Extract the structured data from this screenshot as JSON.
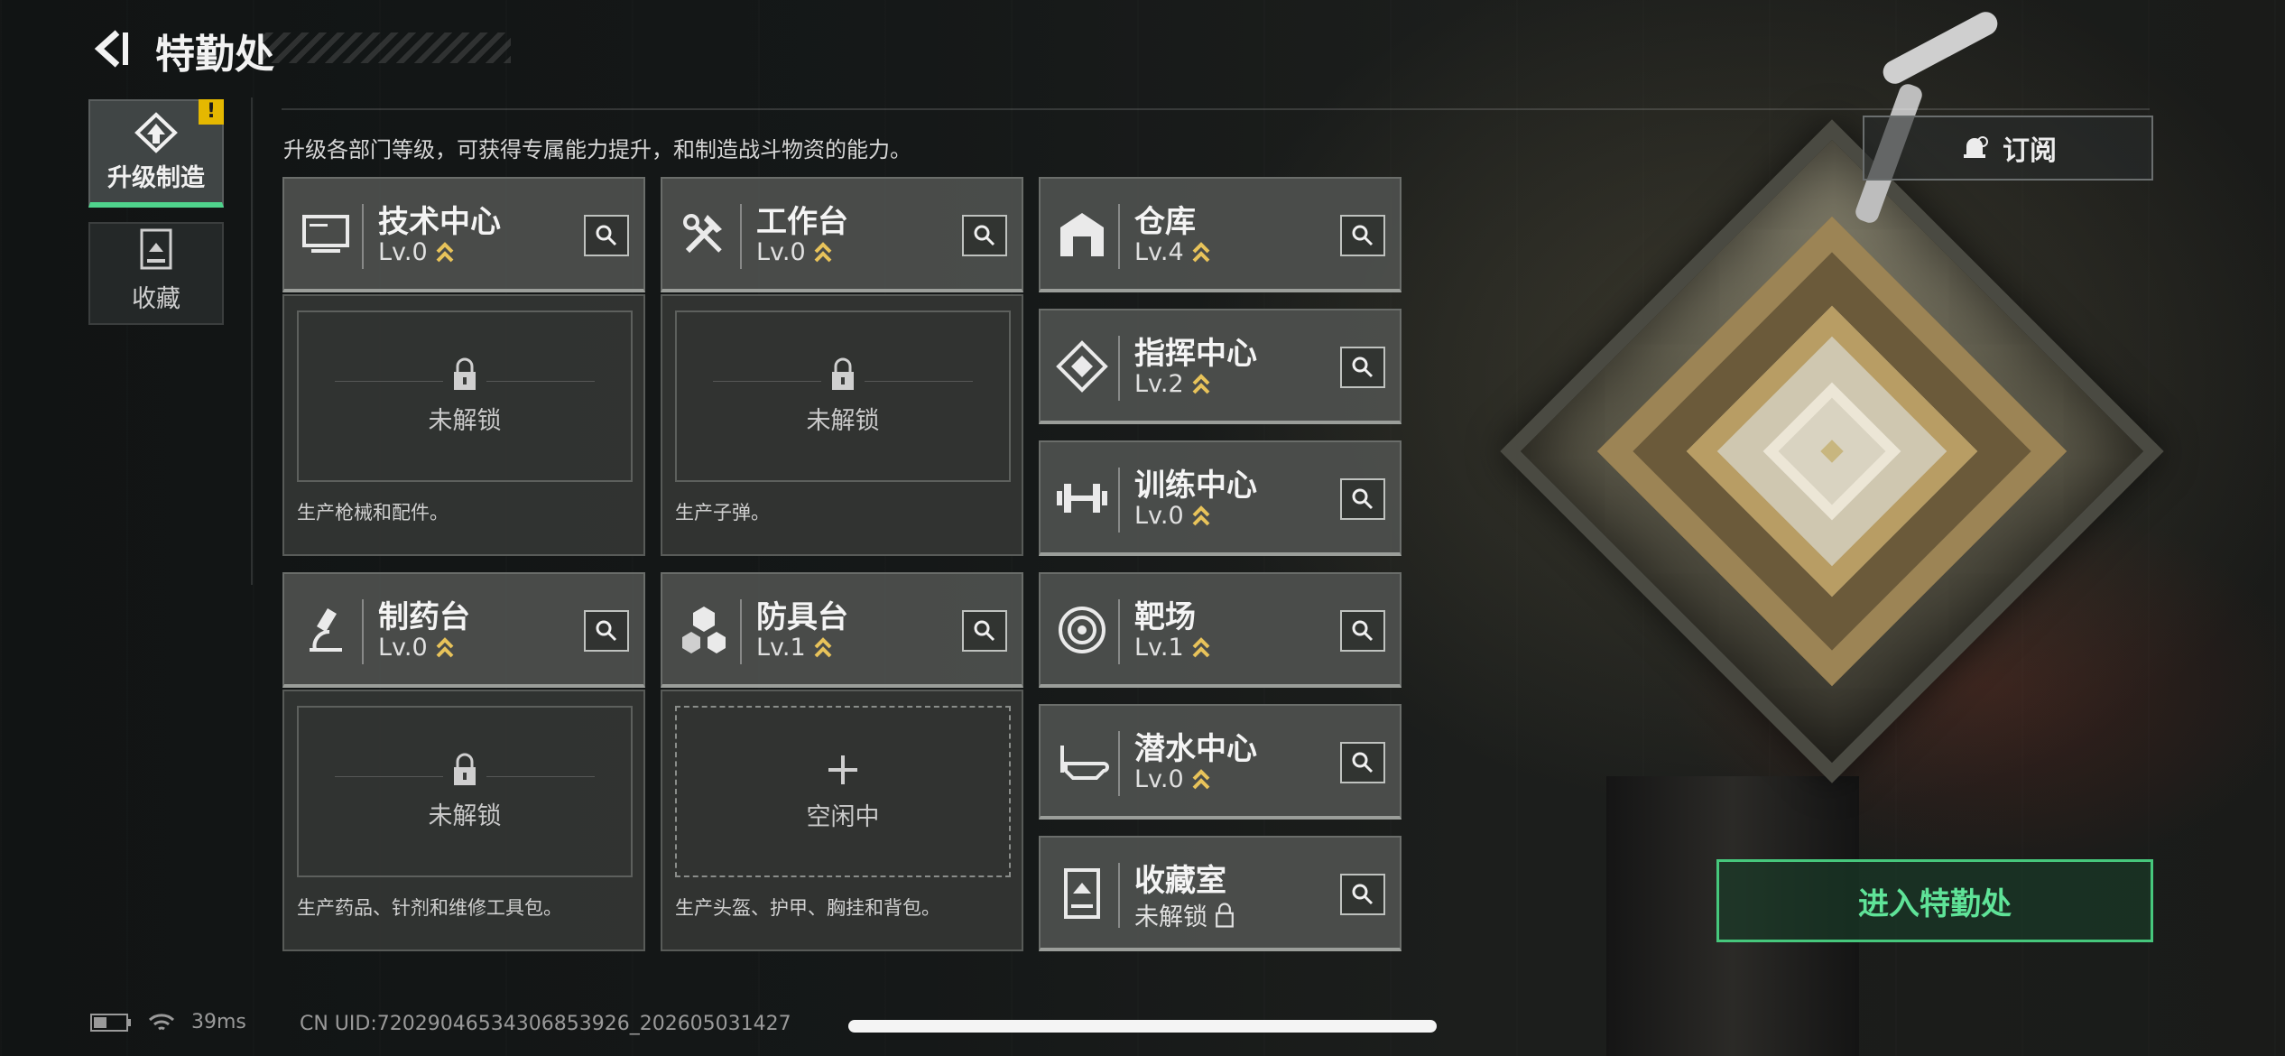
{
  "header": {
    "title": "特勤处"
  },
  "sidebar": {
    "tabs": [
      {
        "label": "升级制造",
        "active": true,
        "badge": "!"
      },
      {
        "label": "收藏",
        "active": false
      }
    ]
  },
  "description": "升级各部门等级，可获得专属能力提升，和制造战斗物资的能力。",
  "subscribe_label": "订阅",
  "facilities": {
    "tech": {
      "name": "技术中心",
      "level": "Lv.0",
      "slot_status": "未解锁",
      "desc": "生产枪械和配件。"
    },
    "workbench": {
      "name": "工作台",
      "level": "Lv.0",
      "slot_status": "未解锁",
      "desc": "生产子弹。"
    },
    "warehouse": {
      "name": "仓库",
      "level": "Lv.4"
    },
    "command": {
      "name": "指挥中心",
      "level": "Lv.2"
    },
    "training": {
      "name": "训练中心",
      "level": "Lv.0"
    },
    "pharmacy": {
      "name": "制药台",
      "level": "Lv.0",
      "slot_status": "未解锁",
      "desc": "生产药品、针剂和维修工具包。"
    },
    "armor": {
      "name": "防具台",
      "level": "Lv.1",
      "slot_status": "空闲中",
      "desc": "生产头盔、护甲、胸挂和背包。"
    },
    "range": {
      "name": "靶场",
      "level": "Lv.1"
    },
    "diving": {
      "name": "潜水中心",
      "level": "Lv.0"
    },
    "collection": {
      "name": "收藏室",
      "level": "未解锁"
    }
  },
  "enter_label": "进入特勤处",
  "status": {
    "ping": "39ms",
    "uid": "CN UID:7202904653430685392​6_202605031427"
  },
  "colors": {
    "accent_green": "#46c77c",
    "level_chevron": "#e8c35a",
    "warning": "#e5b800"
  }
}
